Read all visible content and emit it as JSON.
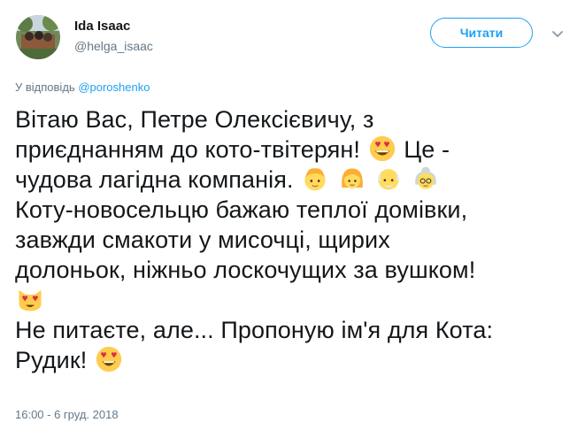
{
  "author": {
    "name": "Ida Isaac",
    "handle": "@helga_isaac"
  },
  "actions": {
    "follow_label": "Читати",
    "more_icon": "chevron-down-icon"
  },
  "reply": {
    "prefix": "У відповідь",
    "mention": "@poroshenko"
  },
  "tweet": {
    "lines": [
      "Вітаю Вас, Петре Олексієвичу, з",
      "приєднанням до кото-твітерян!",
      "Це -",
      "чудова лагідна компанія.",
      "Коту-новосельцю бажаю теплої домівки,",
      "завжди смакоти у мисочці, щирих",
      "долоньок, ніжньо лоскочущих за вушком!",
      "Не питаєте, але... Пропоную ім'я для Кота:",
      "Рудик!"
    ],
    "emojis": [
      "heart-eyes-emoji",
      "boy-emoji",
      "girl-emoji",
      "old-man-emoji",
      "old-woman-emoji",
      "cat-heart-eyes-emoji",
      "heart-eyes-emoji"
    ]
  },
  "timestamp": "16:00 - 6 груд. 2018",
  "colors": {
    "accent": "#1da1f2",
    "text": "#14171a",
    "muted": "#657786"
  }
}
